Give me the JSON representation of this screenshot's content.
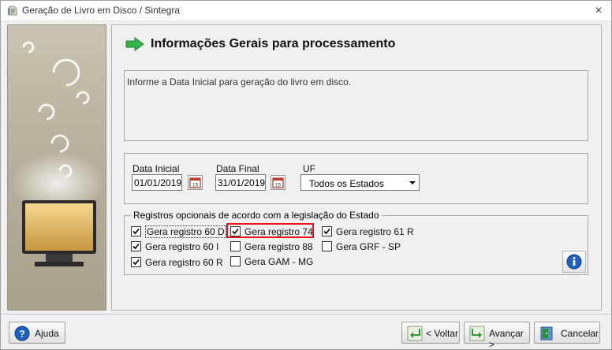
{
  "window": {
    "title": "Geração de Livro em Disco / Sintegra",
    "close_glyph": "✕"
  },
  "main": {
    "heading": "Informações Gerais para processamento",
    "info_text": "Informe a Data Inicial para geração do livro em disco."
  },
  "dates": {
    "start_label": "Data Inicial",
    "start_value": "01/01/2019",
    "end_label": "Data Final",
    "end_value": "31/01/2019",
    "uf_label": "UF",
    "uf_value": "Todos os Estados",
    "calendar_glyph": "15"
  },
  "registros": {
    "legend": "Registros opcionais de acordo com a legislação do Estado",
    "items": [
      {
        "label": "Gera registro 60 D",
        "checked": true
      },
      {
        "label": "Gera registro 60 I",
        "checked": true
      },
      {
        "label": "Gera registro 60 R",
        "checked": true
      },
      {
        "label": "Gera registro 74",
        "checked": true
      },
      {
        "label": "Gera registro 88",
        "checked": false
      },
      {
        "label": "Gera GAM - MG",
        "checked": false
      },
      {
        "label": "Gera registro 61 R",
        "checked": true
      },
      {
        "label": "Gera GRF - SP",
        "checked": false
      }
    ]
  },
  "footer": {
    "help_label": "Ajuda",
    "back_label": "< Voltar",
    "next_label": "Avançar >",
    "cancel_label": "Cancelar"
  },
  "colors": {
    "highlight": "#e5131c",
    "arrow_green": "#33b24a",
    "help_blue": "#1e5fbf"
  }
}
